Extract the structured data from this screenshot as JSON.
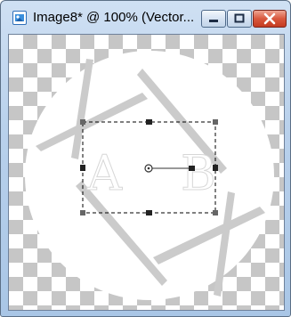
{
  "window": {
    "title": "Image8* @ 100% (Vector...",
    "icon": "paint-shop-app-icon",
    "buttons": {
      "minimize": "minimize-icon",
      "maximize": "maximize-icon",
      "close": "close-icon"
    }
  },
  "canvas": {
    "background": "transparency-checkerboard",
    "shape_color": "#ffffff",
    "text_object": {
      "chars": [
        "A",
        "B"
      ]
    },
    "selection": {
      "style": "dashed-bounding-box"
    }
  }
}
